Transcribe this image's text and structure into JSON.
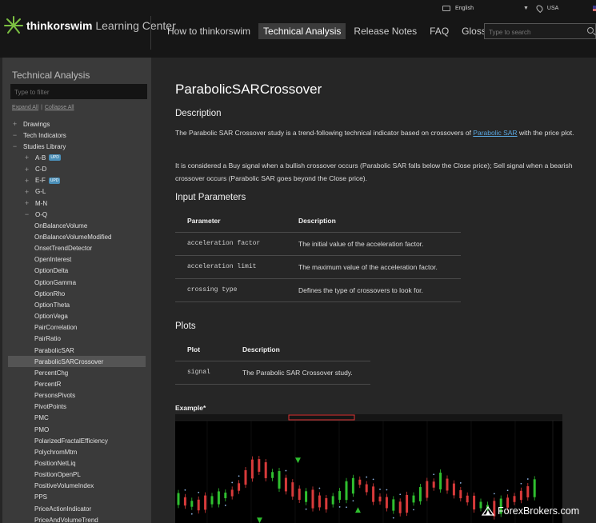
{
  "header": {
    "brand": "thinkorswim",
    "brand_sub": "Learning Center",
    "language": "English",
    "country": "USA",
    "nav": [
      {
        "label": "How to thinkorswim",
        "active": false
      },
      {
        "label": "Technical Analysis",
        "active": true
      },
      {
        "label": "Release Notes",
        "active": false
      },
      {
        "label": "FAQ",
        "active": false
      },
      {
        "label": "Glossary",
        "active": false
      }
    ],
    "search_placeholder": "Type to search"
  },
  "sidebar": {
    "title": "Technical Analysis",
    "filter_placeholder": "Type to filter",
    "expand_all": "Expand All",
    "separator": "|",
    "collapse_all": "Collapse All",
    "items": [
      {
        "label": "Drawings",
        "sign": "+",
        "level": 0
      },
      {
        "label": "Tech Indicators",
        "sign": "−",
        "level": 0
      },
      {
        "label": "Studies Library",
        "sign": "−",
        "level": 1
      },
      {
        "label": "A-B",
        "sign": "+",
        "level": 2,
        "badge": "UPD"
      },
      {
        "label": "C-D",
        "sign": "+",
        "level": 2
      },
      {
        "label": "E-F",
        "sign": "+",
        "level": 2,
        "badge": "UPD"
      },
      {
        "label": "G-L",
        "sign": "+",
        "level": 2
      },
      {
        "label": "M-N",
        "sign": "+",
        "level": 2
      },
      {
        "label": "O-Q",
        "sign": "−",
        "level": 2
      },
      {
        "label": "OnBalanceVolume",
        "level": 3
      },
      {
        "label": "OnBalanceVolumeModified",
        "level": 3
      },
      {
        "label": "OnsetTrendDetector",
        "level": 3
      },
      {
        "label": "OpenInterest",
        "level": 3
      },
      {
        "label": "OptionDelta",
        "level": 3
      },
      {
        "label": "OptionGamma",
        "level": 3
      },
      {
        "label": "OptionRho",
        "level": 3
      },
      {
        "label": "OptionTheta",
        "level": 3
      },
      {
        "label": "OptionVega",
        "level": 3
      },
      {
        "label": "PairCorrelation",
        "level": 3
      },
      {
        "label": "PairRatio",
        "level": 3
      },
      {
        "label": "ParabolicSAR",
        "level": 3
      },
      {
        "label": "ParabolicSARCrossover",
        "level": 3,
        "selected": true
      },
      {
        "label": "PercentChg",
        "level": 3
      },
      {
        "label": "PercentR",
        "level": 3
      },
      {
        "label": "PersonsPivots",
        "level": 3
      },
      {
        "label": "PivotPoints",
        "level": 3
      },
      {
        "label": "PMC",
        "level": 3
      },
      {
        "label": "PMO",
        "level": 3
      },
      {
        "label": "PolarizedFractalEfficiency",
        "level": 3
      },
      {
        "label": "PolychromMtm",
        "level": 3
      },
      {
        "label": "PositionNetLiq",
        "level": 3
      },
      {
        "label": "PositionOpenPL",
        "level": 3
      },
      {
        "label": "PositiveVolumeIndex",
        "level": 3
      },
      {
        "label": "PPS",
        "level": 3
      },
      {
        "label": "PriceActionIndicator",
        "level": 3
      },
      {
        "label": "PriceAndVolumeTrend",
        "level": 3
      }
    ]
  },
  "main": {
    "title": "ParabolicSARCrossover",
    "description_heading": "Description",
    "description_p1_before": "The Parabolic SAR Crossover study is a trend-following technical indicator based on crossovers of ",
    "description_p1_link": "Parabolic SAR",
    "description_p1_after": " with the price plot.",
    "description_p2": "It is considered a Buy signal when a bullish crossover occurs (Parabolic SAR falls below the Close price); Sell signal when a bearish crossover occurs (Parabolic SAR goes beyond the Close price).",
    "input_heading": "Input Parameters",
    "input_table": {
      "headers": [
        "Parameter",
        "Description"
      ],
      "rows": [
        [
          "acceleration factor",
          "The initial value of the acceleration factor."
        ],
        [
          "acceleration limit",
          "The maximum value of the acceleration factor."
        ],
        [
          "crossing type",
          "Defines the type of crossovers to look for."
        ]
      ]
    },
    "plots_heading": "Plots",
    "plots_table": {
      "headers": [
        "Plot",
        "Description"
      ],
      "rows": [
        [
          "signal",
          "The Parabolic SAR Crossover study."
        ]
      ]
    },
    "example_label": "Example*"
  },
  "watermark": "ForexBrokers.com",
  "colors": {
    "header_bg": "#161616",
    "sidebar_bg": "#3a3a3a",
    "main_bg": "#262626",
    "link": "#5aa7e0",
    "badge": "#4a8fb8",
    "logo_green": "#7cc142"
  }
}
